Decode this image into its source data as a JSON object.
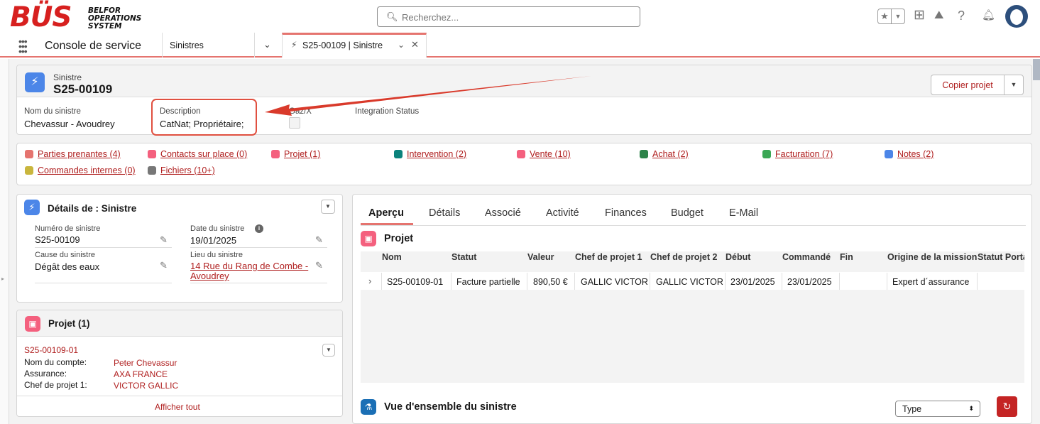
{
  "header": {
    "logo_main": "BÜS",
    "logo_sub": "BELFOR OPERATIONS SYSTEM",
    "search_placeholder": "Recherchez..."
  },
  "nav": {
    "app_name": "Console de service",
    "tabs": [
      {
        "label": "Sinistres"
      },
      {
        "label": "S25-00109 | Sinistre",
        "active": true
      }
    ]
  },
  "record": {
    "type_label": "Sinistre",
    "name": "S25-00109",
    "copy_button": "Copier projet",
    "fields": [
      {
        "label": "Nom du sinistre",
        "value": "Chevassur - Avoudrey"
      },
      {
        "label": "Description",
        "value": "CatNat; Propriétaire;"
      },
      {
        "label": "Gaz/X",
        "value": ""
      },
      {
        "label": "Integration Status",
        "value": ""
      }
    ]
  },
  "related_links": [
    {
      "label": "Parties prenantes (4)",
      "color": "#e5746f"
    },
    {
      "label": "Contacts sur place (0)",
      "color": "#f4607e"
    },
    {
      "label": "Projet (1)",
      "color": "#f4607e"
    },
    {
      "label": "Intervention (2)",
      "color": "#0b827c"
    },
    {
      "label": "Vente (10)",
      "color": "#f4607e"
    },
    {
      "label": "Achat (2)",
      "color": "#2e844a"
    },
    {
      "label": "Facturation (7)",
      "color": "#3ba755"
    },
    {
      "label": "Notes (2)",
      "color": "#4c86e8"
    },
    {
      "label": "Commandes internes (0)",
      "color": "#c9b63d"
    },
    {
      "label": "Fichiers (10+)",
      "color": "#777777"
    }
  ],
  "details": {
    "title": "Détails de : Sinistre",
    "fields": [
      {
        "label": "Numéro de sinistre",
        "value": "S25-00109"
      },
      {
        "label": "Date du sinistre",
        "value": "19/01/2025"
      },
      {
        "label": "Cause du sinistre",
        "value": "Dégât des eaux"
      },
      {
        "label": "Lieu du sinistre",
        "value": "14 Rue du Rang de Combe - Avoudrey"
      }
    ]
  },
  "projet_card": {
    "title": "Projet (1)",
    "record": "S25-00109-01",
    "rows": [
      {
        "label": "Nom du compte:",
        "value": "Peter Chevassur"
      },
      {
        "label": "Assurance:",
        "value": "AXA FRANCE"
      },
      {
        "label": "Chef de projet 1:",
        "value": "VICTOR GALLIC"
      }
    ],
    "view_all": "Afficher tout"
  },
  "right_panel": {
    "tabs": [
      "Aperçu",
      "Détails",
      "Associé",
      "Activité",
      "Finances",
      "Budget",
      "E-Mail"
    ],
    "active_tab": "Aperçu",
    "projet_title": "Projet",
    "table": {
      "headers": [
        "Nom",
        "Statut",
        "Valeur",
        "Chef de projet 1",
        "Chef de projet 2",
        "Début",
        "Commandé",
        "Fin",
        "Origine de la mission",
        "Statut Porta"
      ],
      "rows": [
        [
          "S25-00109-01",
          "Facture partielle",
          "890,50 €",
          "GALLIC VICTOR",
          "GALLIC VICTOR",
          "23/01/2025",
          "23/01/2025",
          "",
          "Expert d´assurance",
          ""
        ]
      ]
    },
    "overview_title": "Vue d'ensemble du sinistre",
    "type_select": "Type"
  }
}
